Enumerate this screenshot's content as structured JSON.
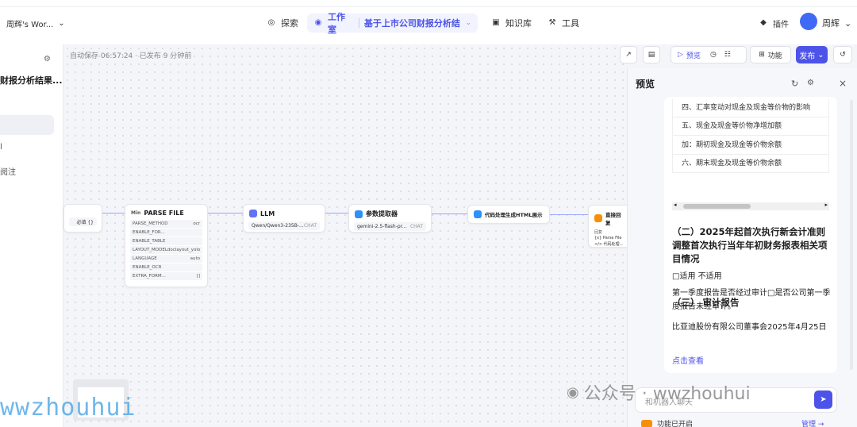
{
  "header": {
    "workspace": "周辉's Wor...",
    "nav": {
      "explore": "探索",
      "studio": "工作室",
      "knowledge": "知识库",
      "tools": "工具",
      "plugins": "插件"
    },
    "project": "基于上市公司财报分析结...",
    "user": "周辉"
  },
  "left": {
    "title": "财报分析结果...",
    "items": [
      "l",
      "阅注"
    ]
  },
  "canvas": {
    "autosave": "自动保存 06:57:24 · 已发布 9 分钟前",
    "preview_btn": "预览",
    "func_btn": "功能",
    "publish_btn": "发布"
  },
  "nodes": {
    "start": {
      "row": "必填 {}"
    },
    "parse": {
      "title": "PARSE FILE",
      "tag": "Min",
      "params": [
        [
          "PARSE_METHOD",
          "ocr"
        ],
        [
          "ENABLE_FOR...",
          ""
        ],
        [
          "ENABLE_TABLE",
          ""
        ],
        [
          "LAYOUT_MODEL",
          "doclayout_yolo"
        ],
        [
          "LANGUAGE",
          "auto"
        ],
        [
          "ENABLE_OCR",
          ""
        ],
        [
          "EXTRA_FORM...",
          "[]"
        ]
      ]
    },
    "llm": {
      "title": "LLM",
      "model": "Qwen/Qwen3-235B-...",
      "badge": "CHAT"
    },
    "extract": {
      "title": "参数提取器",
      "model": "gemini-2.5-flash-pr...",
      "badge": "CHAT"
    },
    "code": {
      "title": "代码处理生成HTML展示"
    },
    "reply": {
      "title": "直接回复",
      "l1": "回复",
      "l2": "{x} Parse File",
      "l3": "</> 代码处理..."
    }
  },
  "preview": {
    "title": "预览",
    "table_rows": [
      "四、汇率变动对现金及现金等价物的影响",
      "五、现金及现金等价物净增加额",
      "加：期初现金及现金等价物余额",
      "六、期末现金及现金等价物余额"
    ],
    "h_new": "（二）2025年起首次执行新会计准则调整首次执行当年年初财务报表相关项目情况",
    "p_na": "□适用 不适用",
    "h_audit": "（三） 审计报告",
    "p_audit": "第一季度报告是否经过审计□是否公司第一季度报告未经审计。",
    "p_sign": "比亚迪股份有限公司董事会2025年4月25日",
    "link": "点击查看",
    "input_placeholder": "和机器人聊天",
    "bottom_status": "功能已开启",
    "bottom_manage": "管理"
  },
  "watermarks": {
    "main": "wwzhouhui",
    "gzh": "公众号 · wwzhouhui"
  }
}
